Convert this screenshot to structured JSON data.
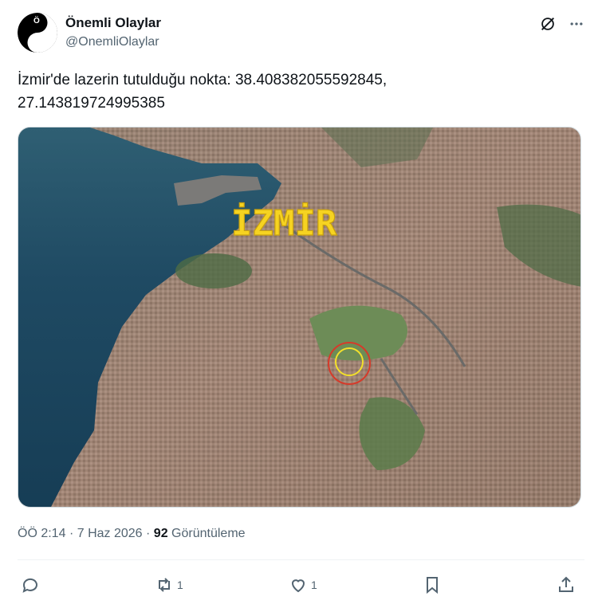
{
  "author": {
    "display_name": "Önemli Olaylar",
    "handle": "@OnemliOlaylar",
    "avatar_letter": "Ö"
  },
  "tweet": {
    "text_line1": "İzmir'de lazerin tutulduğu nokta: 38.408382055592845,",
    "text_line2": "27.143819724995385"
  },
  "media": {
    "overlay_text": "İZMİR"
  },
  "meta": {
    "time": "ÖÖ 2:14",
    "separator": "·",
    "date": "7 Haz 2026",
    "views_count": "92",
    "views_label": "Görüntüleme"
  },
  "actions": {
    "reply_count": "",
    "retweet_count": "1",
    "like_count": "1"
  },
  "colors": {
    "text_primary": "#0f1419",
    "text_secondary": "#536471",
    "overlay_yellow": "#f6d321"
  }
}
